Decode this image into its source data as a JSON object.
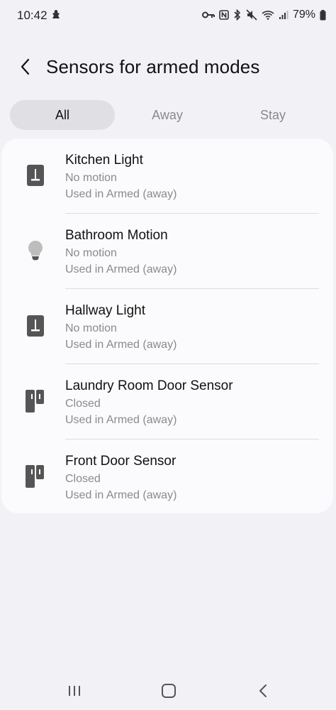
{
  "status_bar": {
    "time": "10:42",
    "battery": "79%",
    "icons": [
      "notification-icon",
      "key-icon",
      "nfc-icon",
      "bluetooth-icon",
      "mute-icon",
      "wifi-icon",
      "signal-icon",
      "battery-icon"
    ]
  },
  "header": {
    "title": "Sensors for armed modes",
    "back_icon": "chevron-left-icon"
  },
  "tabs": [
    {
      "label": "All",
      "active": true
    },
    {
      "label": "Away",
      "active": false
    },
    {
      "label": "Stay",
      "active": false
    }
  ],
  "sensors": [
    {
      "name": "Kitchen Light",
      "status": "No motion",
      "usage": "Used in Armed (away)",
      "icon": "switch-icon"
    },
    {
      "name": "Bathroom Motion",
      "status": "No motion",
      "usage": "Used in Armed (away)",
      "icon": "bulb-icon"
    },
    {
      "name": "Hallway Light",
      "status": "No motion",
      "usage": "Used in Armed (away)",
      "icon": "switch-icon"
    },
    {
      "name": "Laundry Room Door Sensor",
      "status": "Closed",
      "usage": "Used in Armed (away)",
      "icon": "door-sensor-icon"
    },
    {
      "name": "Front Door Sensor",
      "status": "Closed",
      "usage": "Used in Armed (away)",
      "icon": "door-sensor-icon"
    }
  ],
  "nav": {
    "icons": [
      "recents-icon",
      "home-icon",
      "back-icon"
    ]
  },
  "colors": {
    "background": "#f2f2f6",
    "card": "#fbfbfd",
    "active_tab": "#e0e0e4",
    "secondary_text": "#8a8a8e",
    "icon": "#555555"
  }
}
